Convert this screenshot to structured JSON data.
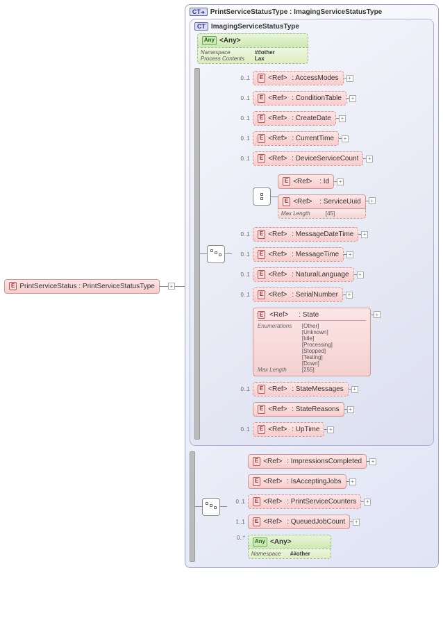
{
  "root": {
    "tag": "E",
    "label": "PrintServiceStatus : PrintServiceStatusType"
  },
  "outer": {
    "tag": "CT",
    "title": "PrintServiceStatusType : ImagingServiceStatusType"
  },
  "inner": {
    "tag": "CT",
    "title": "ImagingServiceStatusType"
  },
  "any1": {
    "tag": "Any",
    "label": "<Any>",
    "k_ns": "Namespace",
    "v_ns": "##other",
    "k_pc": "Process Contents",
    "v_pc": "Lax"
  },
  "choice": {
    "id": {
      "occurs": "",
      "tag": "E",
      "ref": "<Ref>",
      "label": ": Id"
    },
    "uuid": {
      "occurs": "",
      "tag": "E",
      "ref": "<Ref>",
      "label": ": ServiceUuid",
      "k_ml": "Max Length",
      "v_ml": "[45]"
    }
  },
  "refs": [
    {
      "occurs": "0..1",
      "tag": "E",
      "ref": "<Ref>",
      "label": ": AccessModes",
      "dashed": true
    },
    {
      "occurs": "0..1",
      "tag": "E",
      "ref": "<Ref>",
      "label": ": ConditionTable",
      "dashed": true
    },
    {
      "occurs": "0..1",
      "tag": "E",
      "ref": "<Ref>",
      "label": ": CreateDate",
      "dashed": true
    },
    {
      "occurs": "0..1",
      "tag": "E",
      "ref": "<Ref>",
      "label": ": CurrentTime",
      "dashed": true
    },
    {
      "occurs": "0..1",
      "tag": "E",
      "ref": "<Ref>",
      "label": ": DeviceServiceCount",
      "dashed": true
    }
  ],
  "refs2": [
    {
      "occurs": "0..1",
      "tag": "E",
      "ref": "<Ref>",
      "label": ": MessageDateTime",
      "dashed": true
    },
    {
      "occurs": "0..1",
      "tag": "E",
      "ref": "<Ref>",
      "label": ": MessageTime",
      "dashed": true
    },
    {
      "occurs": "0..1",
      "tag": "E",
      "ref": "<Ref>",
      "label": ": NaturalLanguage",
      "dashed": true
    },
    {
      "occurs": "0..1",
      "tag": "E",
      "ref": "<Ref>",
      "label": ": SerialNumber",
      "dashed": true
    }
  ],
  "state": {
    "tag": "E",
    "ref": "<Ref>",
    "label": ": State",
    "k_enum": "Enumerations",
    "enums": [
      "[Other]",
      "[Unknown]",
      "[Idle]",
      "[Processing]",
      "[Stopped]",
      "[Testing]",
      "[Down]"
    ],
    "k_ml": "Max Length",
    "v_ml": "[255]"
  },
  "refs3": [
    {
      "occurs": "0..1",
      "tag": "E",
      "ref": "<Ref>",
      "label": ": StateMessages",
      "dashed": true
    },
    {
      "occurs": "",
      "tag": "E",
      "ref": "<Ref>",
      "label": ": StateReasons",
      "dashed": false
    },
    {
      "occurs": "0..1",
      "tag": "E",
      "ref": "<Ref>",
      "label": ": UpTime",
      "dashed": true
    }
  ],
  "outer_refs": [
    {
      "occurs": "",
      "tag": "E",
      "ref": "<Ref>",
      "label": ": ImpressionsCompleted",
      "dashed": false
    },
    {
      "occurs": "",
      "tag": "E",
      "ref": "<Ref>",
      "label": ": IsAcceptingJobs",
      "dashed": false
    },
    {
      "occurs": "0..1",
      "tag": "E",
      "ref": "<Ref>",
      "label": ": PrintServiceCounters",
      "dashed": true
    },
    {
      "occurs": "1..1",
      "tag": "E",
      "ref": "<Ref>",
      "label": ": QueuedJobCount",
      "dashed": false
    }
  ],
  "any2": {
    "occurs": "0..*",
    "tag": "Any",
    "label": "<Any>",
    "k_ns": "Namespace",
    "v_ns": "##other"
  }
}
